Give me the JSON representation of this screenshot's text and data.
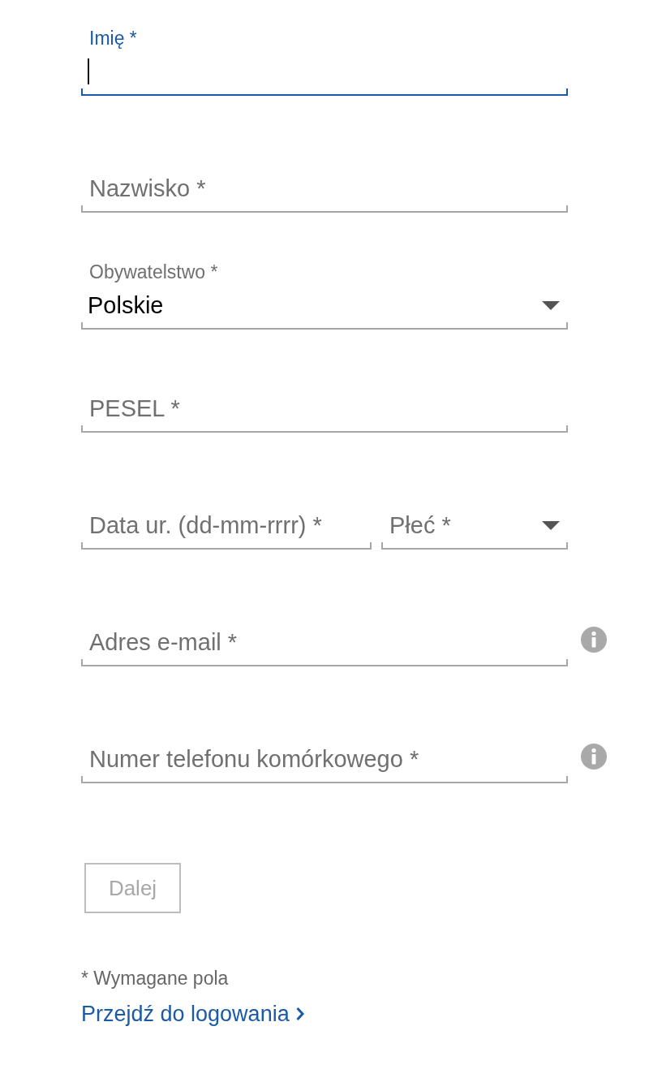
{
  "rows": [
    {
      "info": false,
      "fields": [
        {
          "kind": "text",
          "label": "Imię *",
          "focused": true
        }
      ]
    },
    {
      "info": false,
      "fields": [
        {
          "kind": "text",
          "label": "Nazwisko *",
          "focused": false
        }
      ]
    },
    {
      "info": false,
      "fields": [
        {
          "kind": "select",
          "label": "Obywatelstwo *",
          "value": "Polskie",
          "focused": false
        }
      ]
    },
    {
      "info": false,
      "fields": [
        {
          "kind": "text",
          "label": "PESEL *",
          "focused": false
        }
      ]
    },
    {
      "info": false,
      "fields": [
        {
          "kind": "text",
          "label": "Data ur. (dd-mm-rrrr) *",
          "focused": false
        },
        {
          "kind": "select",
          "label": "Płeć *",
          "focused": false
        }
      ]
    },
    {
      "info": true,
      "fields": [
        {
          "kind": "text",
          "label": "Adres e-mail *",
          "focused": false
        }
      ]
    },
    {
      "info": true,
      "fields": [
        {
          "kind": "text",
          "label": "Numer telefonu komórkowego *",
          "focused": false
        }
      ]
    }
  ],
  "button": {
    "label": "Dalej",
    "disabled": true
  },
  "required_note": "* Wymagane pola",
  "login_link": {
    "label": "Przejdź do logowania"
  }
}
